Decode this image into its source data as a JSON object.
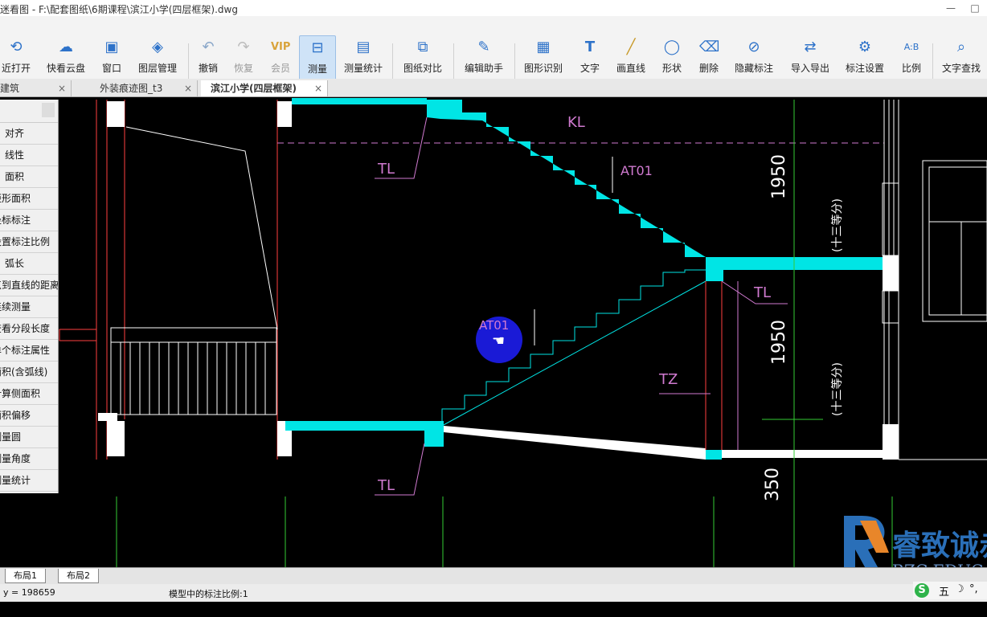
{
  "window": {
    "title": "迷看图 - F:\\配套图纸\\6期课程\\滨江小学(四层框架).dwg",
    "min": "—",
    "max": "□"
  },
  "toolbar": {
    "buttons": [
      {
        "label": "近打开",
        "icon": "clock-icon"
      },
      {
        "label": "快看云盘",
        "icon": "cloud-icon"
      },
      {
        "label": "窗口",
        "icon": "window-icon"
      },
      {
        "label": "图层管理",
        "icon": "layers-icon"
      },
      {
        "label": "撤销",
        "icon": "undo-icon"
      },
      {
        "label": "恢复",
        "icon": "redo-icon"
      },
      {
        "label": "会员",
        "icon": "vip-icon"
      },
      {
        "label": "测量",
        "icon": "measure-icon"
      },
      {
        "label": "测量统计",
        "icon": "measure-stats-icon"
      },
      {
        "label": "图纸对比",
        "icon": "compare-icon"
      },
      {
        "label": "编辑助手",
        "icon": "edit-assist-icon"
      },
      {
        "label": "图形识别",
        "icon": "shape-recognize-icon"
      },
      {
        "label": "文字",
        "icon": "text-icon"
      },
      {
        "label": "画直线",
        "icon": "line-icon"
      },
      {
        "label": "形状",
        "icon": "shape-icon"
      },
      {
        "label": "删除",
        "icon": "eraser-icon"
      },
      {
        "label": "隐藏标注",
        "icon": "eye-hide-icon"
      },
      {
        "label": "导入导出",
        "icon": "import-export-icon"
      },
      {
        "label": "标注设置",
        "icon": "settings-icon"
      },
      {
        "label": "比例",
        "icon": "scale-icon"
      },
      {
        "label": "文字查找",
        "icon": "text-search-icon"
      }
    ]
  },
  "tabs": [
    {
      "label": "建筑"
    },
    {
      "label": "外装痕迹图_t3"
    },
    {
      "label": "滨江小学(四层框架)"
    }
  ],
  "tab_close": "×",
  "sidebar": {
    "items": [
      "对齐",
      "线性",
      "面积",
      "矩形面积",
      "坐标标注",
      "设置标注比例",
      "弧长",
      "点到直线的距离",
      "连续测量",
      "查看分段长度",
      "单个标注属性",
      "面积(含弧线)",
      "计算侧面积",
      "面积偏移",
      "测量圆",
      "测量角度",
      "测量统计"
    ]
  },
  "drawing": {
    "labels": {
      "kl": "KL",
      "tl1": "TL",
      "tl2": "TL",
      "tl3": "TL",
      "at01_a": "AT01",
      "at01_b": "AT01",
      "tz": "TZ",
      "dim1": "1950",
      "dim2": "1950",
      "dim3": "350",
      "note1": "(十三等分)",
      "note2": "(十三等分)"
    },
    "colors": {
      "stair": "#00e5e5",
      "wall": "#ffffff",
      "cut": "#ff3c3c",
      "dim": "#33cc33",
      "label": "#d07ad0"
    }
  },
  "layout_tabs": [
    "布局1",
    "布局2"
  ],
  "status": {
    "coord": "y = 198659",
    "scale": "模型中的标注比例:1"
  },
  "watermark": {
    "brand": "睿致诚赤",
    "sub": "RZC EDUCA"
  },
  "ime": {
    "s": "S",
    "mode": "五",
    "moon": "☽",
    "punct": "°,"
  }
}
